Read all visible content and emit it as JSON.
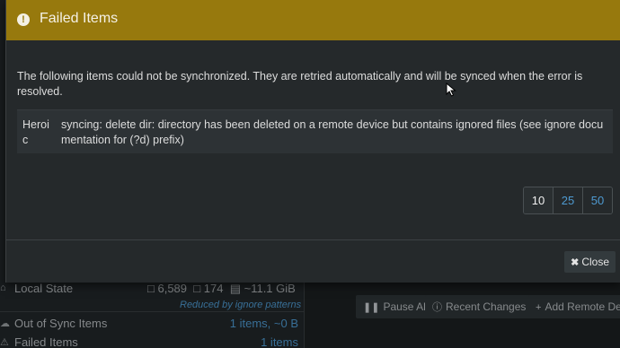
{
  "background": {
    "local_state": {
      "label": "Local State",
      "files": "6,589",
      "folders": "174",
      "size": "~11.1 GiB",
      "note": "Reduced by ignore patterns"
    },
    "out_of_sync": {
      "label": "Out of Sync Items",
      "value": "1 items, ~0 B"
    },
    "failed": {
      "label": "Failed Items",
      "value": "1 items"
    },
    "buttons": {
      "pause_all": "Pause All",
      "recent_changes": "Recent Changes",
      "add_remote_device": "Add Remote Devi"
    }
  },
  "modal": {
    "title": "Failed Items",
    "description": "The following items could not be synchronized. They are retried automatically and will be synced when the error is resolved.",
    "items": [
      {
        "path": "Heroic",
        "error": "syncing: delete dir: directory has been deleted on a remote device but contains ignored files (see ignore documentation for (?d) prefix)"
      }
    ],
    "page_sizes": [
      "10",
      "25",
      "50"
    ],
    "selected_page_size": "10",
    "close_label": "Close"
  },
  "colors": {
    "header": "#97790d",
    "link": "#4e9ad1",
    "modal_bg": "#25292b"
  }
}
